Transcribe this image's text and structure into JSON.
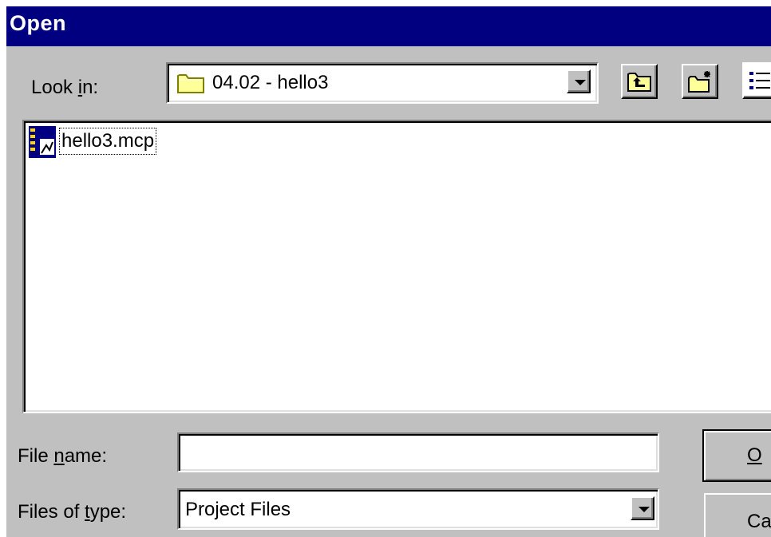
{
  "window": {
    "title": "Open"
  },
  "look_in": {
    "label_pre": "Look ",
    "label_accel": "i",
    "label_post": "n:",
    "value": "04.02 - hello3",
    "icon": "folder-icon"
  },
  "toolbar": {
    "up_icon": "up-one-level-icon",
    "new_folder_icon": "new-folder-icon",
    "view_icon": "list-view-icon"
  },
  "files": [
    {
      "name": "hello3.mcp",
      "icon": "project-file-icon",
      "selected": true
    }
  ],
  "file_name": {
    "label_pre": "File ",
    "label_accel": "n",
    "label_post": "ame:",
    "value": ""
  },
  "file_type": {
    "label_pre": "Files of ",
    "label_accel": "t",
    "label_post": "ype:",
    "value": "Project Files"
  },
  "buttons": {
    "open_label": "O",
    "cancel_label": "Ca"
  },
  "colors": {
    "titlebar": "#000080",
    "face": "#c0c0c0",
    "folder": "#ffff99"
  }
}
